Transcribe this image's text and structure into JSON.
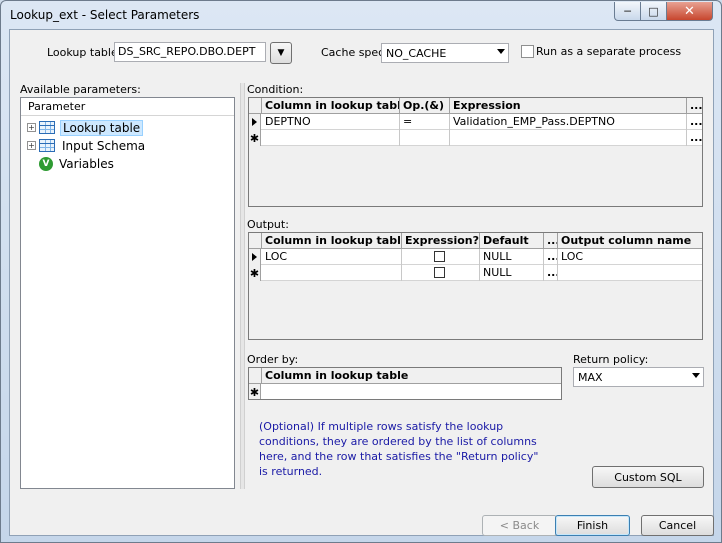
{
  "window": {
    "title": "Lookup_ext - Select Parameters",
    "controls": {
      "minimize": "─",
      "maximize": "□",
      "close": "✕"
    }
  },
  "top": {
    "lookup_table_label": "Lookup table:",
    "lookup_table_value": "DS_SRC_REPO.DBO.DEPT",
    "cache_spec_label": "Cache spec:",
    "cache_spec_value": "NO_CACHE",
    "separate_process_label": "Run as a separate process",
    "separate_process_checked": false
  },
  "left_panel": {
    "label": "Available parameters:",
    "header": "Parameter",
    "items": [
      {
        "label": "Lookup table",
        "icon": "table-icon",
        "expander": "+",
        "selected": true
      },
      {
        "label": "Input Schema",
        "icon": "table-icon",
        "expander": "+",
        "selected": false
      },
      {
        "label": "Variables",
        "icon": "variable-icon",
        "expander": "",
        "selected": false
      }
    ],
    "variable_glyph": "V"
  },
  "condition": {
    "label": "Condition:",
    "headers": [
      "Column in lookup table",
      "Op.(&)",
      "Expression",
      "..."
    ],
    "rows": [
      {
        "marker": "current",
        "col": "DEPTNO",
        "op": "=",
        "expr": "Validation_EMP_Pass.DEPTNO",
        "ellipsis": "..."
      },
      {
        "marker": "new",
        "col": "",
        "op": "",
        "expr": "",
        "ellipsis": "..."
      }
    ]
  },
  "output": {
    "label": "Output:",
    "headers": [
      "Column in lookup table",
      "Expression?",
      "Default",
      "...",
      "Output column name"
    ],
    "rows": [
      {
        "marker": "current",
        "col": "LOC",
        "default": "NULL",
        "ellipsis": "...",
        "out": "LOC"
      },
      {
        "marker": "new",
        "col": "",
        "default": "NULL",
        "ellipsis": "...",
        "out": ""
      }
    ]
  },
  "order_by": {
    "label": "Order by:",
    "header": "Column in lookup table",
    "note": "(Optional) If multiple rows satisfy the lookup conditions, they are ordered by the list of columns here, and the row that satisfies the \"Return policy\" is returned."
  },
  "return_policy": {
    "label": "Return policy:",
    "value": "MAX"
  },
  "buttons": {
    "custom_sql": "Custom SQL",
    "back": "< Back",
    "finish": "Finish",
    "cancel": "Cancel"
  },
  "markers": {
    "new_row": "✱",
    "dropdown": "▼"
  },
  "colors": {
    "note_text": "#1a1aa6",
    "selection": "#cde8ff"
  }
}
